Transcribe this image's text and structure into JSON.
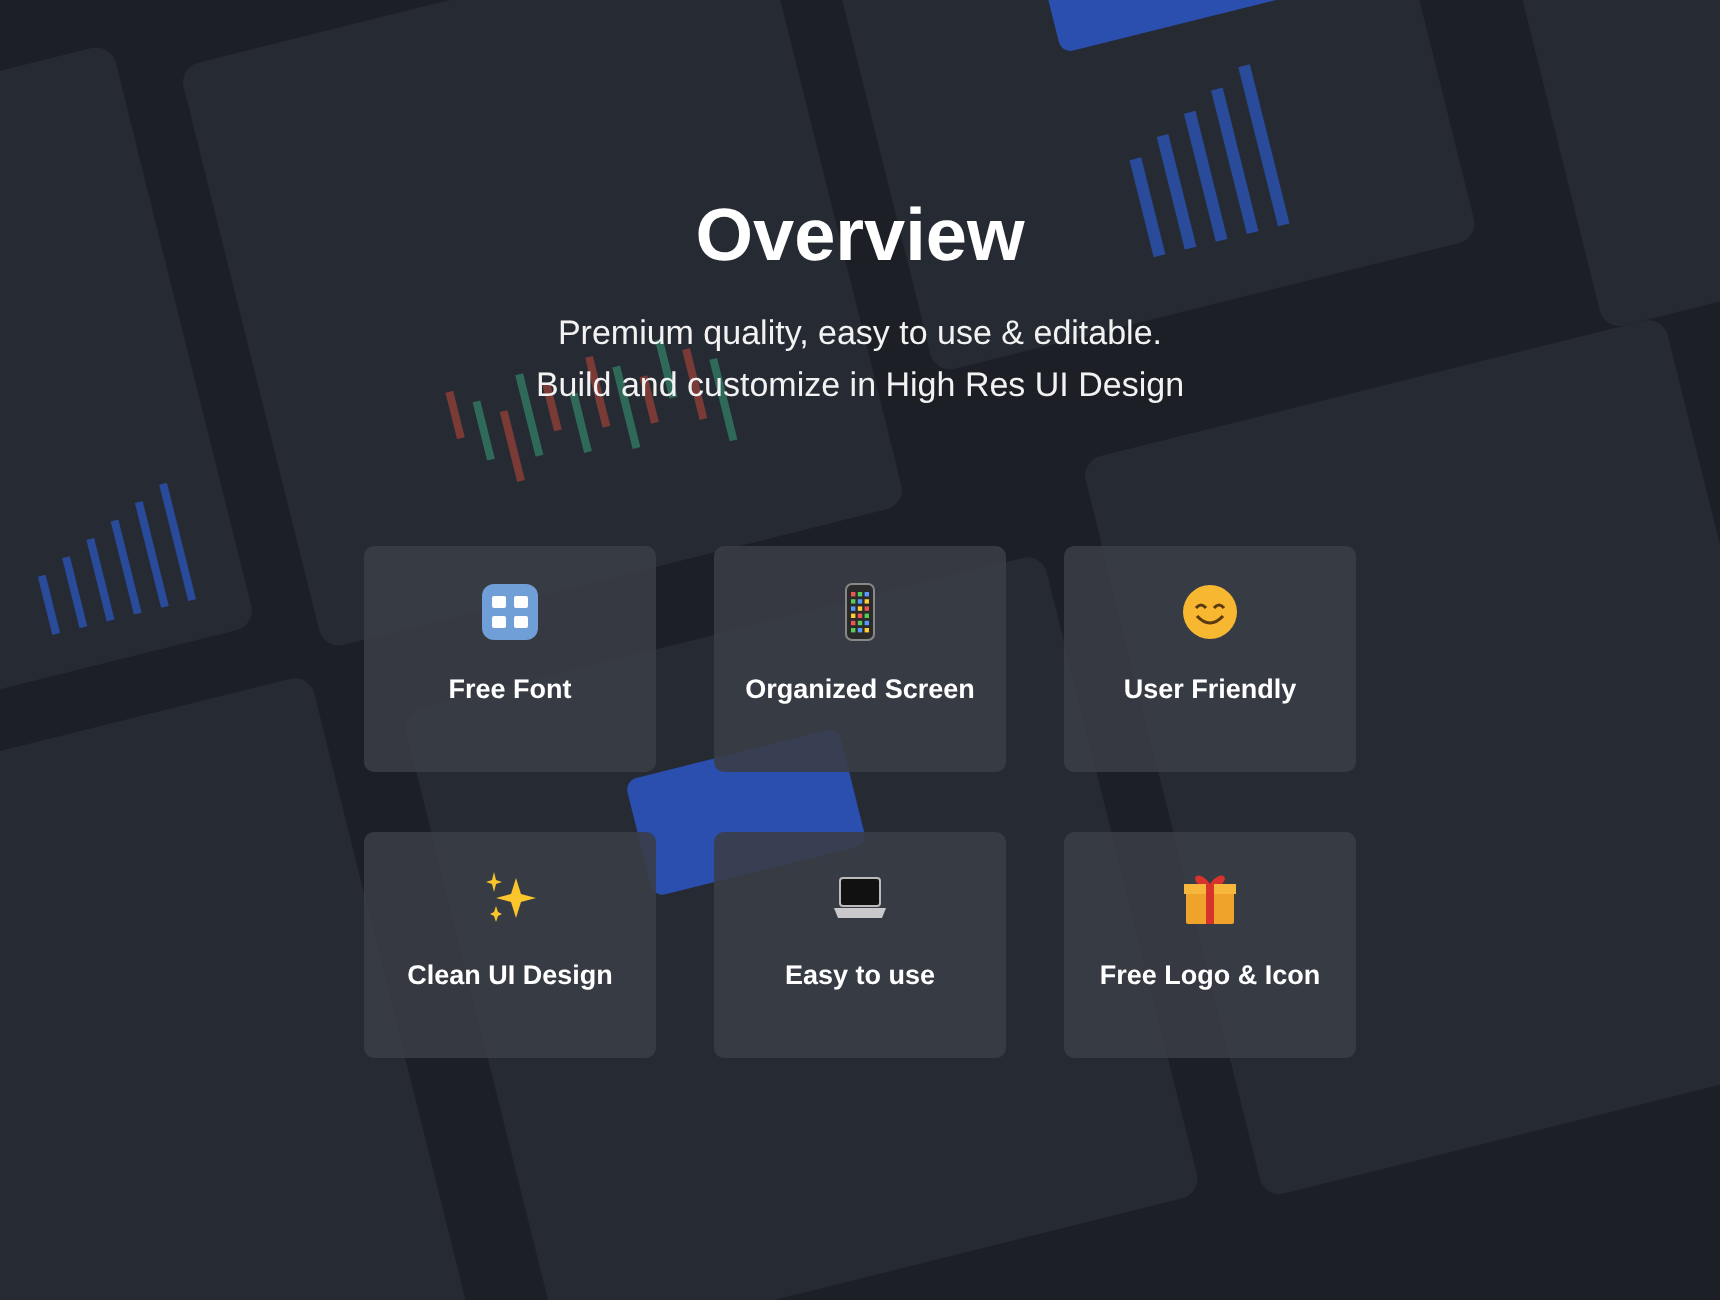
{
  "title": "Overview",
  "subtitle": [
    "Premium quality, easy to use & editable.",
    "Build and customize in High Res UI Design"
  ],
  "features": [
    {
      "kind": "letters",
      "label": "Free Font"
    },
    {
      "kind": "phone",
      "label": "Organized Screen"
    },
    {
      "kind": "smile",
      "label": "User Friendly"
    },
    {
      "kind": "sparkles",
      "label": "Clean UI Design"
    },
    {
      "kind": "laptop",
      "label": "Easy to use"
    },
    {
      "kind": "gift",
      "label": "Free Logo & Icon"
    }
  ]
}
